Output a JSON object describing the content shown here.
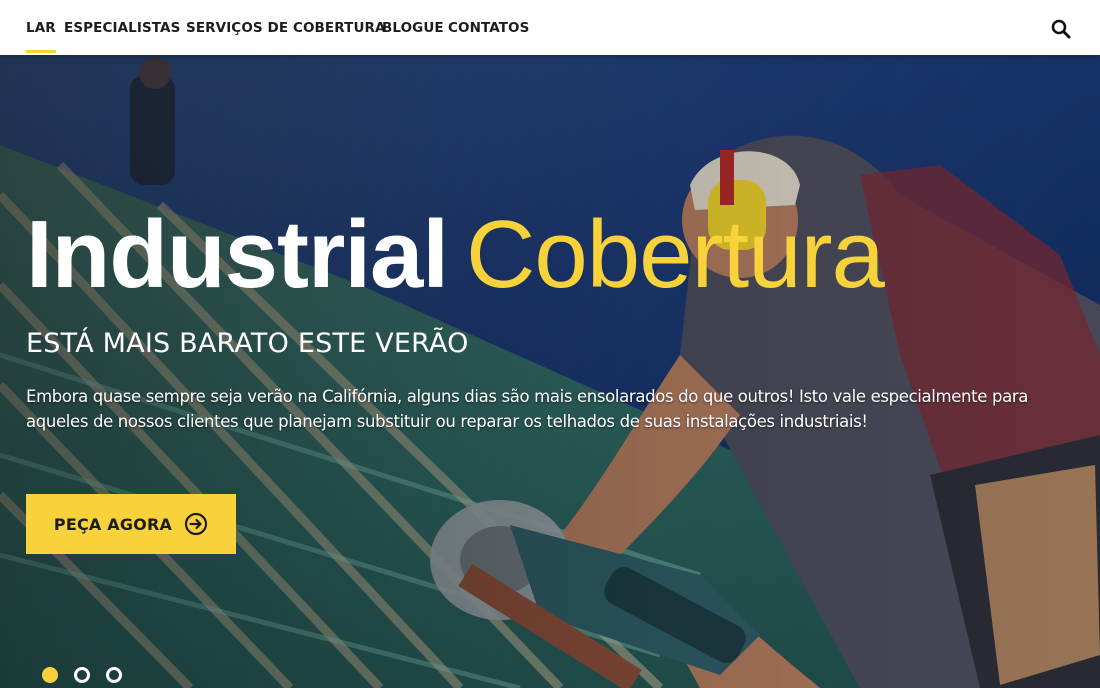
{
  "nav": {
    "items": [
      {
        "label": "LAR",
        "active": true
      },
      {
        "label": "ESPECIALISTAS",
        "active": false
      },
      {
        "label": "SERVIÇOS DE COBERTURA",
        "active": false
      },
      {
        "label": "BLOGUE",
        "active": false
      },
      {
        "label": "CONTATOS",
        "active": false
      }
    ],
    "search_icon": "search-icon"
  },
  "hero": {
    "title_word1": "Industrial",
    "title_word2": "Cobertura",
    "subtitle": "ESTÁ MAIS BARATO ESTE VERÃO",
    "text": "Embora quase sempre seja verão na Califórnia, alguns dias são mais ensolarados do que outros! Isto vale especialmente para aqueles de nossos clientes que planejam substituir ou reparar os telhados de suas instalações industriais!",
    "cta_label": "PEÇA AGORA",
    "cta_icon": "arrow-circle-right-icon"
  },
  "slider": {
    "slide_count": 3,
    "active_index": 0
  },
  "colors": {
    "accent": "#f8d23a",
    "nav_text": "#1c1c1c",
    "hero_text": "#ffffff"
  }
}
